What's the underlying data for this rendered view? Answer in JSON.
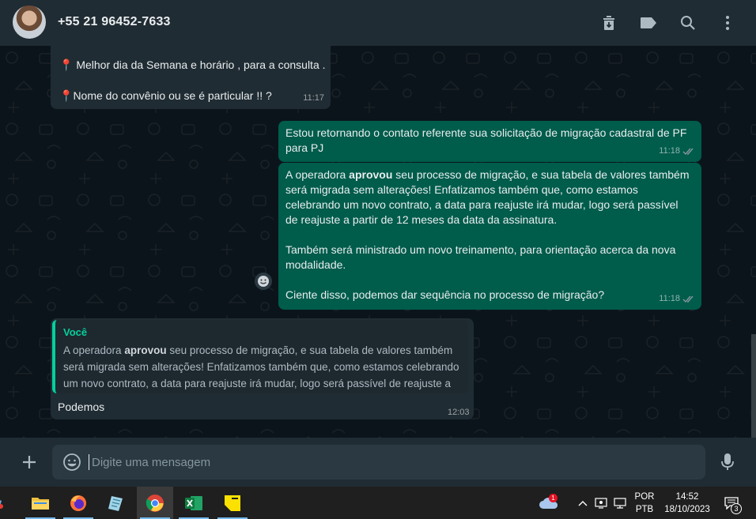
{
  "header": {
    "contact_name": "+55 21 96452-7633",
    "icons": [
      "archive-icon",
      "label-icon",
      "search-icon",
      "menu-icon"
    ]
  },
  "messages": [
    {
      "direction": "in",
      "lines": [
        "Melhor dia da Semana e horário , para a consulta .",
        "",
        "Nome do convênio ou se é particular !! ?"
      ],
      "line1": "Melhor dia da Semana e horário , para a consulta .",
      "line2": "Nome do convênio ou se é particular !! ?",
      "time": "11:17"
    },
    {
      "direction": "out",
      "text": "Estou retornando o contato referente sua solicitação de migração cadastral de PF para PJ",
      "time": "11:18",
      "status": "delivered"
    },
    {
      "direction": "out",
      "p1_prefix": "A operadora ",
      "p1_bold": "aprovou",
      "p1_rest": " seu processo de migração, e sua tabela de valores também será migrada sem alterações! Enfatizamos também que, como estamos celebrando um novo contrato, a data para reajuste irá mudar, logo será passível de reajuste a partir de 12 meses da data da assinatura.",
      "p2": "Também será ministrado um novo treinamento, para orientação acerca da nova modalidade.",
      "p3": "Ciente disso, podemos dar sequência no processo de migração?",
      "time": "11:18",
      "status": "delivered"
    },
    {
      "direction": "in",
      "quote_author": "Você",
      "quote_prefix": "A operadora ",
      "quote_bold": "aprovou",
      "quote_rest": " seu processo de migração, e sua tabela de valores também será migrada sem alterações! Enfatizamos também que, como estamos celebrando um novo contrato, a data para reajuste irá mudar, logo será passível de reajuste a partir ...",
      "text": "Podemos",
      "time": "12:03"
    }
  ],
  "composer": {
    "placeholder": "Digite uma mensagem"
  },
  "taskbar": {
    "apps": [
      "file-explorer",
      "firefox",
      "notes",
      "chrome",
      "excel",
      "sticky-notes"
    ],
    "active_app": "chrome",
    "language": "POR",
    "keyboard": "PTB",
    "time": "14:52",
    "date": "18/10/2023",
    "notification_count": "3",
    "weather_badge": "1"
  },
  "colors": {
    "app_bg": "#0b141a",
    "header_bg": "#202c33",
    "incoming_bubble": "#202c33",
    "outgoing_bubble": "#005c4b",
    "accent": "#06cf9c",
    "tick_color": "#8696a0"
  }
}
